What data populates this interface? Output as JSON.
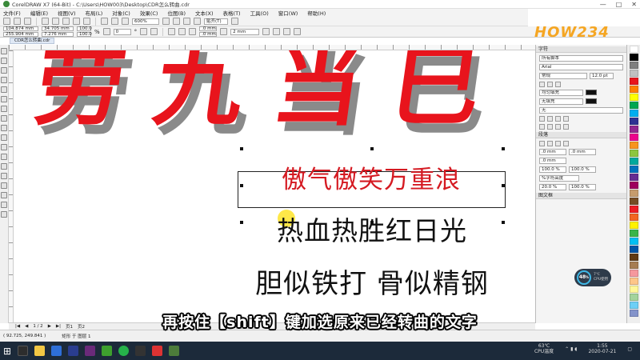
{
  "window": {
    "title": "CorelDRAW X7 (64-Bit) - C:\\Users\\HOW003\\Desktop\\CDR怎么转曲.cdr",
    "controls": [
      "—",
      "□",
      "✕"
    ]
  },
  "menu": {
    "items": [
      "文件(F)",
      "编辑(E)",
      "视图(V)",
      "布局(L)",
      "对象(C)",
      "效果(C)",
      "位图(B)",
      "文本(X)",
      "表格(T)",
      "工具(O)",
      "窗口(W)",
      "帮助(H)"
    ]
  },
  "toolbar": {
    "zoom": "600%",
    "snap_label": "贴齐(T)",
    "x": "104.874 mm",
    "y": "255.904 mm",
    "w": "34.705 mm",
    "h": "7.276 mm",
    "scale_x": "100.0",
    "scale_y": "100.0",
    "unit": "%",
    "angle": "0",
    "angle_unit": "°",
    "corner1": ".0 mm",
    "corner2": ".0 mm",
    "outline": "2 mm"
  },
  "document_tab": "CDR怎么转曲.cdr",
  "logo": "HOW234",
  "canvas": {
    "big_text": "劳 九 当 巳",
    "line_red": "傲气傲笑万重浪",
    "line_2": "热血热胜红日光",
    "line_3": "胆似铁打 骨似精钢"
  },
  "docker": {
    "section_char": "字符",
    "script": "所有脚本",
    "font": "Arial",
    "style": "常规",
    "size": "12.0 pt",
    "fill": "均匀填充",
    "bg_fill": "无填充",
    "outline": "无",
    "section_para": "段落",
    "para_fields": [
      ".0 mm",
      ".0 mm",
      ".0 mm",
      "100.0 %",
      "100.0 %",
      "20.0 %",
      "100.0 %"
    ],
    "line_spacing_unit": "%字符高度",
    "section_frame": "图文框"
  },
  "cpu_widget": {
    "value": "48",
    "unit": "%",
    "temp": "7℃",
    "label": "CPU使用"
  },
  "page_nav": {
    "page": "1 / 2",
    "tabs": [
      "页1",
      "页2"
    ]
  },
  "status": {
    "coords": "( 92.725, 249.841 )",
    "object": "矩形 于 图层 1"
  },
  "subtitle": "再按住【shift】键加选原来已经转曲的文字",
  "tray": {
    "temp": "63℃",
    "temp_label": "CPU温度",
    "time": "1:55",
    "date": "2020-07-21"
  },
  "colors": {
    "accent_red": "#e8141c",
    "logo": "#f5a623",
    "taskbar": "#1c2a3a"
  }
}
